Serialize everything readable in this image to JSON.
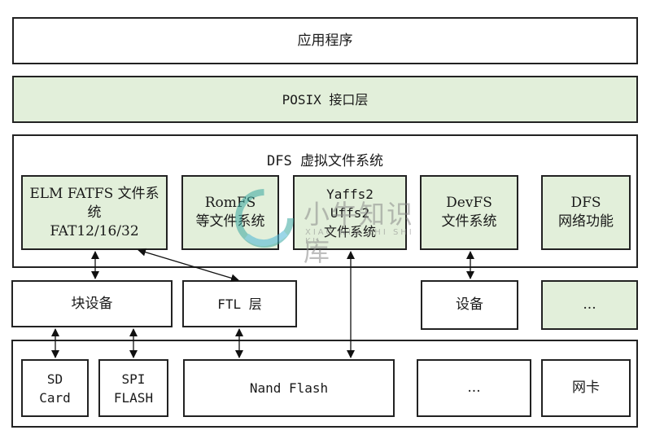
{
  "layers": {
    "app": "应用程序",
    "posix": "POSIX 接口层",
    "dfs_title": "DFS 虚拟文件系统"
  },
  "filesystems": [
    {
      "id": "elm",
      "label": "ELM FATFS 文件系统\nFAT12/16/32"
    },
    {
      "id": "romfs",
      "label": "RomFS\n等文件系统"
    },
    {
      "id": "yaffs",
      "label": "Yaffs2\nUffs2\n文件系统"
    },
    {
      "id": "devfs",
      "label": "DevFS\n文件系统"
    },
    {
      "id": "dfsnet",
      "label": "DFS\n网络功能"
    }
  ],
  "middle": [
    {
      "id": "block",
      "label": "块设备"
    },
    {
      "id": "ftl",
      "label": "FTL 层"
    },
    {
      "id": "device",
      "label": "设备"
    },
    {
      "id": "more",
      "label": "..."
    }
  ],
  "hardware": [
    {
      "id": "sd",
      "label": "SD\nCard"
    },
    {
      "id": "spi",
      "label": "SPI\nFLASH"
    },
    {
      "id": "nand",
      "label": "Nand Flash"
    },
    {
      "id": "more",
      "label": "..."
    },
    {
      "id": "nic",
      "label": "网卡"
    }
  ],
  "watermark": {
    "text": "小牛知识库",
    "sub": "XIAO NIU ZHI SHI KU"
  },
  "colors": {
    "layer_green": "#e2efda",
    "border": "#222222"
  }
}
